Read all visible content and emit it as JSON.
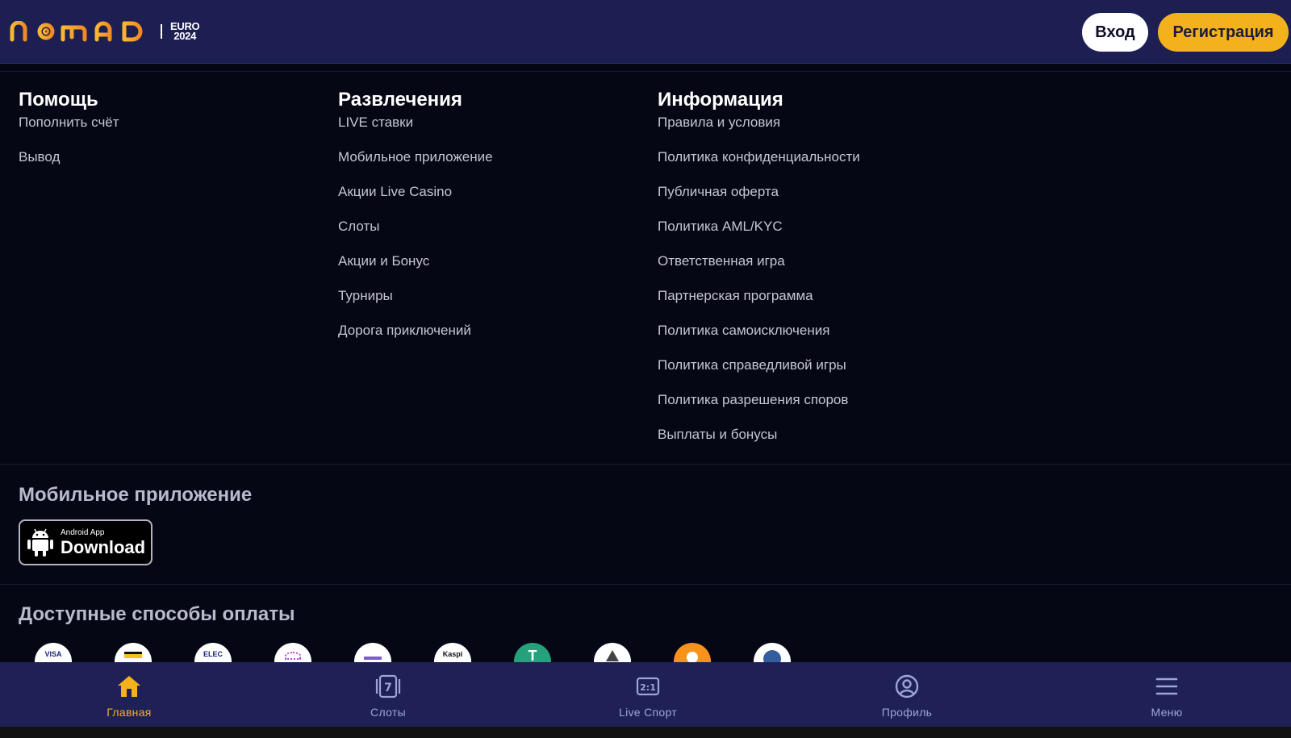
{
  "header": {
    "logo_text": "NOMAD",
    "logo_badge_line1": "EURO",
    "logo_badge_line2": "2024",
    "login_label": "Вход",
    "register_label": "Регистрация"
  },
  "footer": {
    "columns": [
      {
        "title": "Помощь",
        "links": [
          "Пополнить счёт",
          "Вывод"
        ]
      },
      {
        "title": "Развлечения",
        "links": [
          "LIVE ставки",
          "Мобильное приложение",
          "Акции Live Casino",
          "Слоты",
          "Акции и Бонус",
          "Турниры",
          "Дорога приключений"
        ]
      },
      {
        "title": "Информация",
        "links": [
          "Правила и условия",
          "Политика конфиденциальности",
          "Публичная оферта",
          "Политика AML/KYC",
          "Ответственная игра",
          "Партнерская программа",
          "Политика самоисключения",
          "Политика справедливой игры",
          "Политика разрешения споров",
          "Выплаты и бонусы"
        ]
      }
    ],
    "mobile_app": {
      "title": "Мобильное приложение",
      "button_small": "Android App",
      "button_big": "Download"
    },
    "payments": {
      "title": "Доступные способы оплаты",
      "methods": [
        {
          "icon": "visa-icon",
          "label": "VISA"
        },
        {
          "icon": "card-icon",
          "label": ""
        },
        {
          "icon": "elecard-icon",
          "label": "ELEC"
        },
        {
          "icon": "wallet-icon",
          "label": ""
        },
        {
          "icon": "bank-icon",
          "label": ""
        },
        {
          "icon": "kaspi-icon",
          "label": "Kaspi"
        },
        {
          "icon": "tether-icon",
          "label": "T"
        },
        {
          "icon": "ethereum-icon",
          "label": ""
        },
        {
          "icon": "bitcoin-icon",
          "label": ""
        },
        {
          "icon": "litecoin-icon",
          "label": ""
        }
      ]
    }
  },
  "bottom_nav": {
    "items": [
      {
        "label": "Главная",
        "icon": "home-icon",
        "active": true
      },
      {
        "label": "Слоты",
        "icon": "slots-icon",
        "active": false
      },
      {
        "label": "Live Спорт",
        "icon": "live-sport-icon",
        "active": false
      },
      {
        "label": "Профиль",
        "icon": "profile-icon",
        "active": false
      },
      {
        "label": "Меню",
        "icon": "menu-icon",
        "active": false
      }
    ]
  },
  "colors": {
    "header_bg": "#1d1f52",
    "page_bg": "#050714",
    "accent": "#f3b21c",
    "nav_inactive": "#9fa3d6"
  }
}
